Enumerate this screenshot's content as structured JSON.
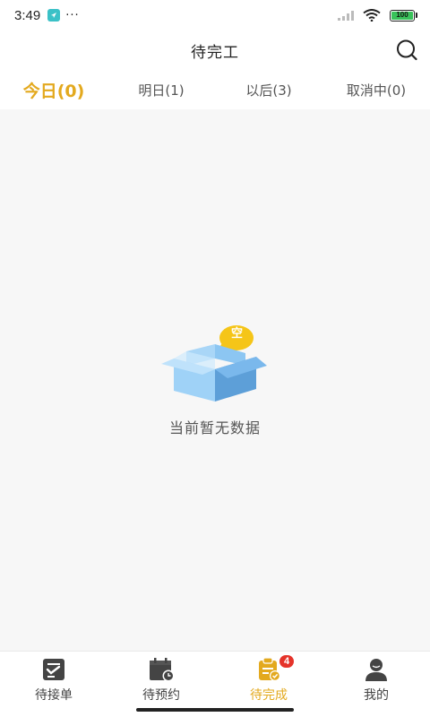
{
  "status_bar": {
    "time": "3:49",
    "more_dots": "···",
    "battery_level": "100",
    "network_label": "ull"
  },
  "header": {
    "title": "待完工",
    "search_icon": "search-icon"
  },
  "tabs": [
    {
      "label": "今日(0)",
      "active": true
    },
    {
      "label": "明日(1)",
      "active": false
    },
    {
      "label": "以后(3)",
      "active": false
    },
    {
      "label": "取消中(0)",
      "active": false
    }
  ],
  "empty_state": {
    "bubble_text": "空",
    "message": "当前暂无数据",
    "icon": "empty-box-icon"
  },
  "bottom_nav": [
    {
      "label": "待接单",
      "icon": "clipboard-check-icon",
      "active": false
    },
    {
      "label": "待预约",
      "icon": "calendar-clock-icon",
      "active": false
    },
    {
      "label": "待完成",
      "icon": "clipboard-done-icon",
      "active": true,
      "badge": "4"
    },
    {
      "label": "我的",
      "icon": "user-icon",
      "active": false
    }
  ],
  "colors": {
    "accent": "#e3a91e",
    "badge": "#e5332a",
    "background": "#f7f7f7"
  }
}
